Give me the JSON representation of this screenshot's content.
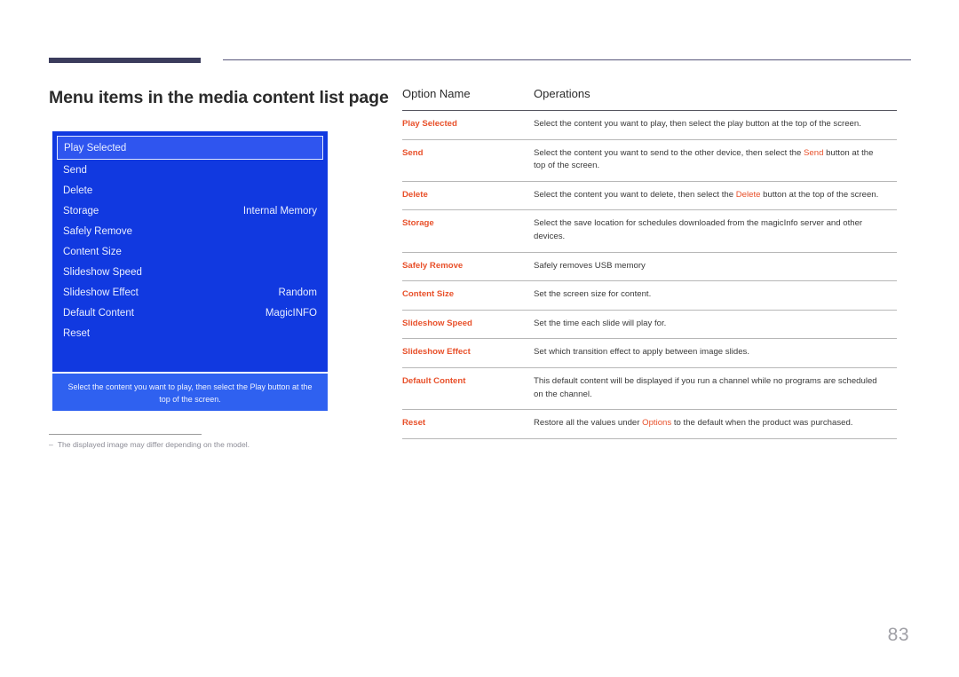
{
  "header": {
    "accent_color": "#3b3c5c",
    "rule_color": "#56557a"
  },
  "page": {
    "title": "Menu items in the media content list page",
    "number": "83",
    "footnote_dash": "–",
    "footnote": "The displayed image may differ depending on the model."
  },
  "osd": {
    "background_color": "#1139e0",
    "highlight_color": "#2f55ef",
    "hint_color": "#2f61f0",
    "items": [
      {
        "label": "Play Selected",
        "value": "",
        "selected": true
      },
      {
        "label": "Send",
        "value": "",
        "selected": false
      },
      {
        "label": "Delete",
        "value": "",
        "selected": false
      },
      {
        "label": "Storage",
        "value": "Internal Memory",
        "selected": false
      },
      {
        "label": "Safely Remove",
        "value": "",
        "selected": false
      },
      {
        "label": "Content Size",
        "value": "",
        "selected": false
      },
      {
        "label": "Slideshow Speed",
        "value": "",
        "selected": false
      },
      {
        "label": "Slideshow Effect",
        "value": "Random",
        "selected": false
      },
      {
        "label": "Default Content",
        "value": "MagicINFO",
        "selected": false
      },
      {
        "label": "Reset",
        "value": "",
        "selected": false
      }
    ],
    "hint": "Select the content you want to play, then select the Play button at the top of the screen."
  },
  "table": {
    "accent_color": "#e8502a",
    "headers": [
      "Option Name",
      "Operations"
    ],
    "rows": [
      {
        "option": "Play Selected",
        "operation_parts": [
          {
            "text": "Select the content you want to play, then select the play button at the top of the screen.",
            "highlight": false
          }
        ]
      },
      {
        "option": "Send",
        "operation_parts": [
          {
            "text": "Select the content you want to send to the other device, then select the ",
            "highlight": false
          },
          {
            "text": "Send",
            "highlight": true
          },
          {
            "text": " button at the top of the screen.",
            "highlight": false
          }
        ]
      },
      {
        "option": "Delete",
        "operation_parts": [
          {
            "text": "Select the content you want to delete, then select the ",
            "highlight": false
          },
          {
            "text": "Delete",
            "highlight": true
          },
          {
            "text": " button at the top of the screen.",
            "highlight": false
          }
        ]
      },
      {
        "option": "Storage",
        "operation_parts": [
          {
            "text": "Select the save location for schedules downloaded from the magicInfo server and other devices.",
            "highlight": false
          }
        ]
      },
      {
        "option": "Safely Remove",
        "operation_parts": [
          {
            "text": "Safely removes USB memory",
            "highlight": false
          }
        ]
      },
      {
        "option": "Content Size",
        "operation_parts": [
          {
            "text": "Set the screen size for content.",
            "highlight": false
          }
        ]
      },
      {
        "option": "Slideshow Speed",
        "operation_parts": [
          {
            "text": "Set the time each slide will play for.",
            "highlight": false
          }
        ]
      },
      {
        "option": "Slideshow Effect",
        "operation_parts": [
          {
            "text": "Set which transition effect to apply between image slides.",
            "highlight": false
          }
        ]
      },
      {
        "option": "Default Content",
        "operation_parts": [
          {
            "text": "This default content will be displayed if you run a channel while no programs are scheduled on the channel.",
            "highlight": false
          }
        ]
      },
      {
        "option": "Reset",
        "operation_parts": [
          {
            "text": "Restore all the values under ",
            "highlight": false
          },
          {
            "text": "Options",
            "highlight": true
          },
          {
            "text": " to the default when the product was purchased.",
            "highlight": false
          }
        ]
      }
    ]
  }
}
